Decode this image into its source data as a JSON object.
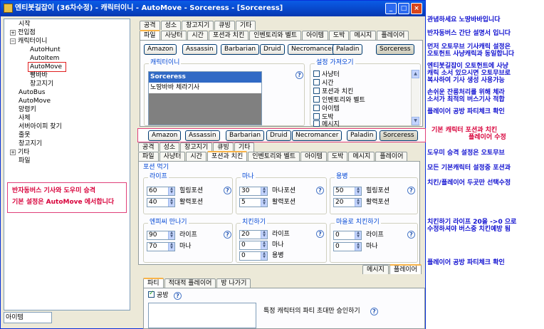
{
  "window": {
    "title": "엔티봇길잡이 (36차수정) - 캐릭터이니 - AutoMove - Sorceress - [Sorceress]",
    "minimize": "_",
    "maximize": "□",
    "close": "×"
  },
  "tree": {
    "items": [
      "시작",
      "전입점",
      "캐릭터이니",
      "AutoHunt",
      "AutoItem",
      "AutoMove",
      "빵바바",
      "창고지기",
      "AutoBus",
      "AutoMove",
      "망령키",
      "사체",
      "서버아이피 찾기",
      "줄못",
      "창고지기",
      "기타",
      "파일"
    ],
    "search": "아이템"
  },
  "top_tabs": {
    "row1": [
      "공격",
      "성소",
      "창고지기",
      "큐빙",
      "기타"
    ],
    "row2": [
      "파일",
      "사냥터",
      "시간",
      "포션과 치킨",
      "인벤토리와 벨트",
      "아이템",
      "도박",
      "메시지",
      "플레이어"
    ]
  },
  "classes": [
    "Amazon",
    "Assassin",
    "Barbarian",
    "Druid",
    "Necromancer",
    "Paladin",
    "Sorceress"
  ],
  "char_group": {
    "label": "캐릭터이니",
    "list": [
      "Sorceress",
      "노땅바바 체라기사"
    ]
  },
  "settings_group": {
    "label": "설정 가져오기",
    "items": [
      "사냥터",
      "시간",
      "포션과 치킨",
      "인벤토리와 벨트",
      "아이템",
      "도박",
      "메시지"
    ]
  },
  "mid_tabs": {
    "row1": [
      "공격",
      "성소",
      "창고지기",
      "큐빙",
      "기타"
    ],
    "row2": [
      "파일",
      "사냥터",
      "시간",
      "포션과 치킨",
      "인벤토리와 벨트",
      "아이템",
      "도박",
      "메시지",
      "플레이어"
    ]
  },
  "potion": {
    "title": "포션 먹기",
    "life": {
      "label": "라이프",
      "values": [
        "60",
        "40"
      ],
      "labels": [
        "힐링포션",
        "활력포션"
      ]
    },
    "mana": {
      "label": "마나",
      "values": [
        "30",
        "5"
      ],
      "labels": [
        "마나포션",
        "활력포션"
      ]
    },
    "merc": {
      "label": "용병",
      "values": [
        "50",
        "20"
      ],
      "labels": [
        "힐링포션",
        "활력포션"
      ]
    }
  },
  "chicken": {
    "ent": {
      "label": "엔피씨 만나기",
      "values": [
        "90",
        "70"
      ],
      "labels": [
        "라이프",
        "마나"
      ]
    },
    "chicken": {
      "label": "치킨하기",
      "values": [
        "20",
        "0",
        "0"
      ],
      "labels": [
        "라이프",
        "마나",
        "용병"
      ]
    },
    "town": {
      "label": "마을로 치킨하기",
      "values": [
        "0",
        "0"
      ],
      "labels": [
        "라이프",
        "마나"
      ]
    }
  },
  "mini_tabs": [
    "메시지",
    "플레이어"
  ],
  "bottom_tabs": [
    "파티",
    "적대적 플레이어",
    "방 나가기"
  ],
  "party": {
    "attack_label": "공방",
    "invite_text": "특정 캐릭터의 파티 초대만 승인하기"
  },
  "annotations": {
    "left_note": [
      "반자동버스 기사와 도우미 승격",
      "기본 설정은 AutoMove 에서합니다"
    ],
    "pink_note": [
      "기본 캐릭터 포션과 치킨",
      "플레이어 수정"
    ],
    "right_notes": [
      "관념하세요  노땅바바입니다",
      "반자동버스 간단 설명서 입니다",
      "먼저 오토무브 기사캐릭 설정은",
      "오토헌트 사냥캐릭과 동일합니다",
      "엔티봇길잡이 오토헌트에 사냥",
      "캐릭 소서 있으시면 오토무브로",
      "복사하여 기사 생성 사용가능",
      "손쉬운 잔릉처리를 위해 체라",
      "소서가 최적의 버스기사 적합",
      "플레이어 공방 파티체크 확인",
      "도우미 승격 설정은 오토무브",
      "모든 기본캐릭터 설정중 포션과",
      "치킨/플레이어 두곳만 선택수정",
      "치킨하기 라이프 20을 ->0 으로",
      "수정하셔야 버스중 치킨예방 됨",
      "플레이어 공방 파티체크 확인"
    ]
  },
  "colors": {
    "titlebar": "#0846c8",
    "selected": "#316ac5",
    "pink": "#e0407a",
    "note": "#1010d0",
    "red_note": "#d8003a"
  }
}
